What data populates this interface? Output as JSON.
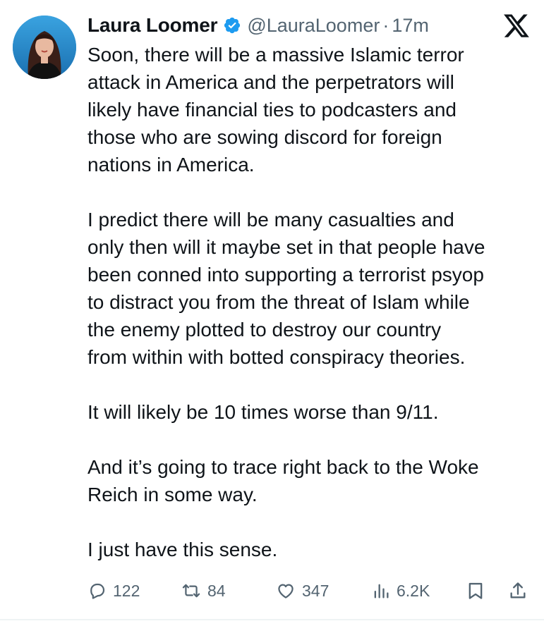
{
  "author": {
    "name": "Laura Loomer",
    "handle": "@LauraLoomer",
    "separator": "·",
    "time": "17m",
    "verified": true,
    "avatar_icon": "profile-photo"
  },
  "platform_icon": "x-logo-icon",
  "tweet": {
    "paragraphs": [
      [
        "Soon, there will be a massive Islamic terror",
        "attack in America and the perpetrators will",
        "likely have financial ties to podcasters and",
        "those who are sowing discord for foreign",
        "nations in America."
      ],
      [
        "I predict there will be many casualties and",
        "only then will it maybe set in that people have",
        "been conned into supporting a terrorist psyop",
        "to distract you from the threat of Islam while",
        "the enemy plotted to destroy our country",
        "from within with botted conspiracy theories."
      ],
      [
        "It will likely be 10 times worse than 9/11."
      ],
      [
        "And it’s going to trace right back to the Woke",
        "Reich in some way."
      ],
      [
        "I just have this sense."
      ]
    ]
  },
  "actions": {
    "replies": "122",
    "reposts": "84",
    "likes": "347",
    "views": "6.2K"
  },
  "colors": {
    "text": "#0f1419",
    "secondary": "#536471",
    "verified": "#1d9bf0"
  }
}
